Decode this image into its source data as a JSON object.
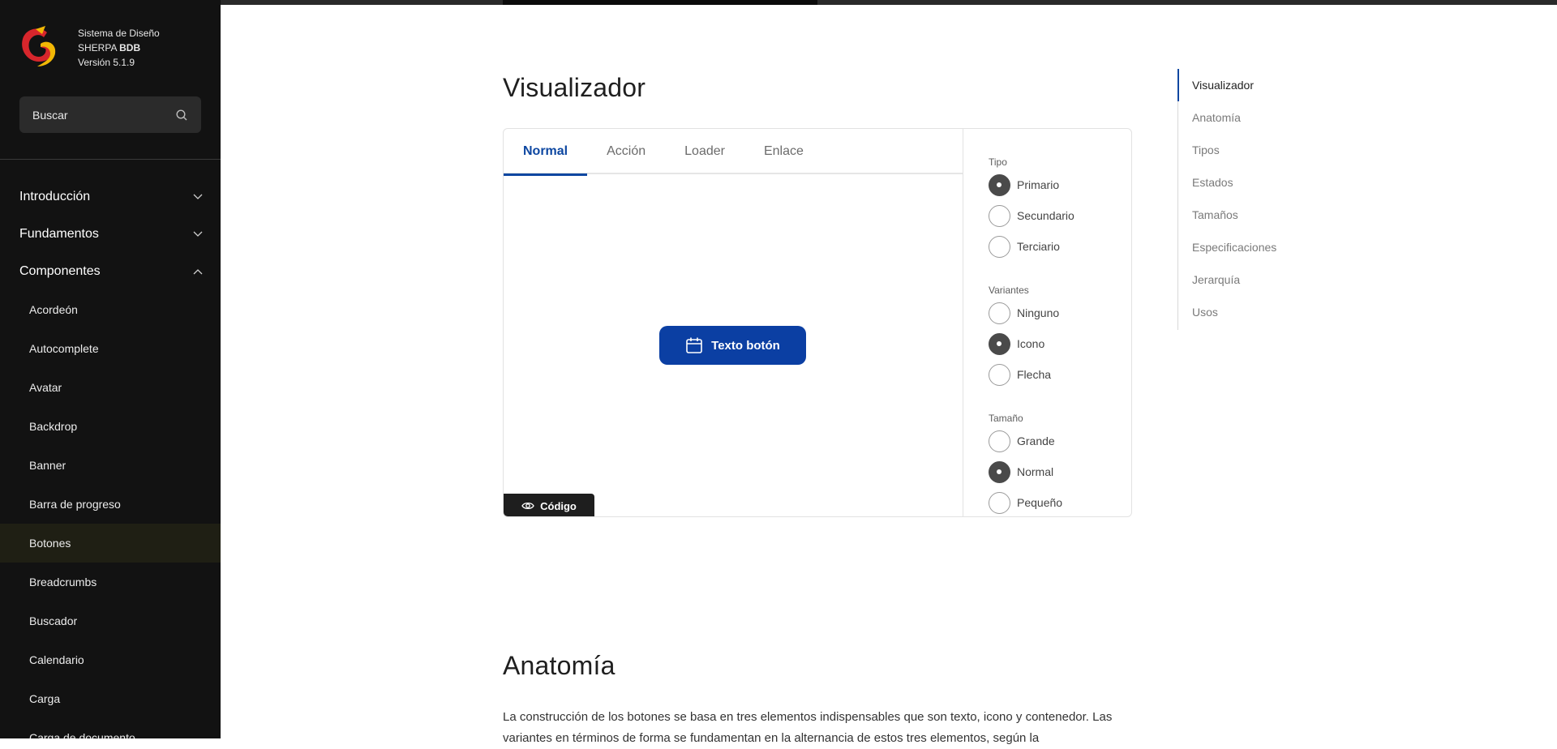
{
  "brand": {
    "line1": "Sistema de Diseño",
    "line2_prefix": "SHERPA ",
    "line2_bold": "BDB",
    "line3": "Versión 5.1.9"
  },
  "search": {
    "placeholder": "Buscar",
    "icon": "search-icon"
  },
  "nav": {
    "sections": [
      {
        "label": "Introducción",
        "expanded": false
      },
      {
        "label": "Fundamentos",
        "expanded": false
      },
      {
        "label": "Componentes",
        "expanded": true
      }
    ],
    "components": [
      "Acordeón",
      "Autocomplete",
      "Avatar",
      "Backdrop",
      "Banner",
      "Barra de progreso",
      "Botones",
      "Breadcrumbs",
      "Buscador",
      "Calendario",
      "Carga",
      "Carga de documento"
    ],
    "active_component": "Botones"
  },
  "main": {
    "title": "Visualizador",
    "tabs": [
      "Normal",
      "Acción",
      "Loader",
      "Enlace"
    ],
    "active_tab": "Normal",
    "demo_button_label": "Texto botón",
    "code_button_label": "Código",
    "anatomy_title": "Anatomía",
    "anatomy_text": "La construcción de los botones se basa en tres elementos indispensables que son texto, icono y contenedor. Las variantes en términos de forma se fundamentan en la alternancia de estos tres elementos, según la"
  },
  "panel": {
    "groups": [
      {
        "label": "Tipo",
        "options": [
          "Primario",
          "Secundario",
          "Terciario"
        ],
        "selected": "Primario"
      },
      {
        "label": "Variantes",
        "options": [
          "Ninguno",
          "Icono",
          "Flecha"
        ],
        "selected": "Icono"
      },
      {
        "label": "Tamaño",
        "options": [
          "Grande",
          "Normal",
          "Pequeño"
        ],
        "selected": "Normal"
      }
    ]
  },
  "toc": {
    "items": [
      "Visualizador",
      "Anatomía",
      "Tipos",
      "Estados",
      "Tamaños",
      "Especificaciones",
      "Jerarquía",
      "Usos"
    ],
    "active": "Visualizador"
  },
  "colors": {
    "primary": "#0b3fa3",
    "sidebar_bg": "#121212",
    "active_item_bg": "#1f1f14",
    "brand_red": "#d7262c",
    "brand_yellow": "#f2b705"
  }
}
